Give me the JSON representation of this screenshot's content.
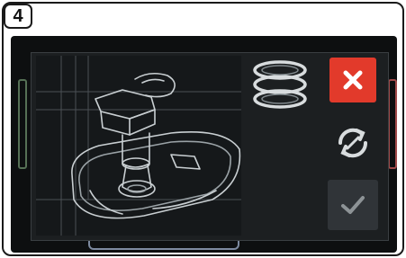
{
  "step": {
    "number": "4"
  },
  "icons": {
    "step_badge": "number-badge",
    "model_preview": "3d-model-wireframe",
    "ring_control": "ring-stack-icon",
    "cancel": "close-icon",
    "reset": "rotate-reset-icon",
    "confirm": "checkmark-icon"
  },
  "colors": {
    "screen": "#0d0f10",
    "dialog": "#1c1f21",
    "cancel": "#e23a2b",
    "confirm": "#303438",
    "icon": "#d8dcde"
  }
}
